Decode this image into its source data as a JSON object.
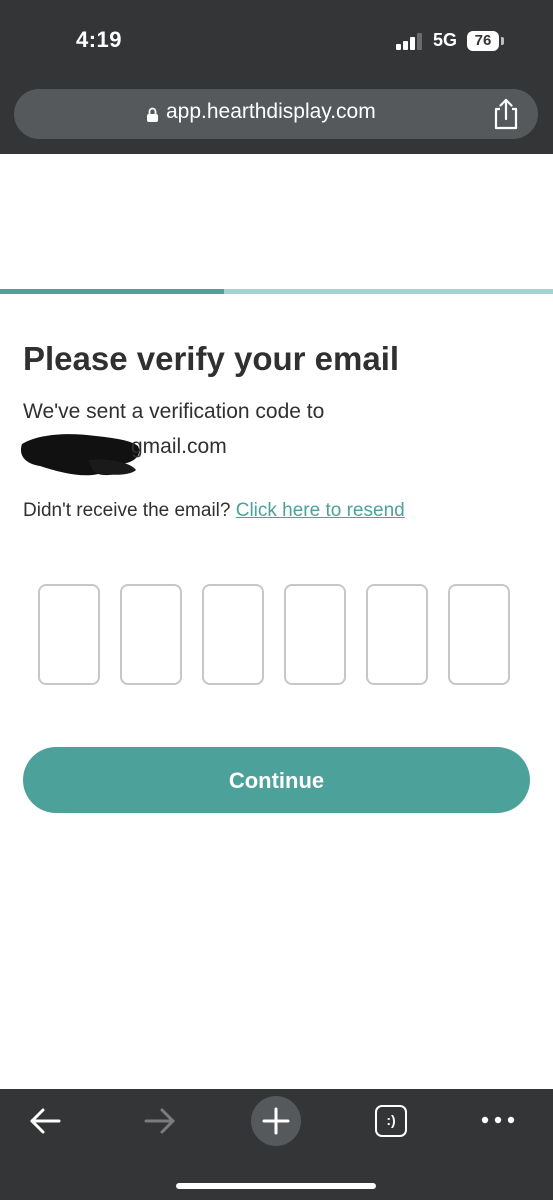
{
  "status_bar": {
    "time": "4:19",
    "network": "5G",
    "battery": "76"
  },
  "browser": {
    "url": "app.hearthdisplay.com"
  },
  "progress": {
    "fraction": 0.405
  },
  "verify": {
    "title": "Please verify your email",
    "sent_text": "We've sent a verification code to",
    "email_visible": "gmail.com",
    "resend_prompt": "Didn't receive the email?",
    "resend_link": "Click here to resend",
    "code_digits": [
      "",
      "",
      "",
      "",
      "",
      ""
    ],
    "continue_label": "Continue"
  },
  "toolbar": {
    "tab_label": ":)"
  },
  "colors": {
    "accent": "#4ca29a",
    "accent_light": "#a3d4ce",
    "chrome": "#333536",
    "text": "#303030"
  }
}
